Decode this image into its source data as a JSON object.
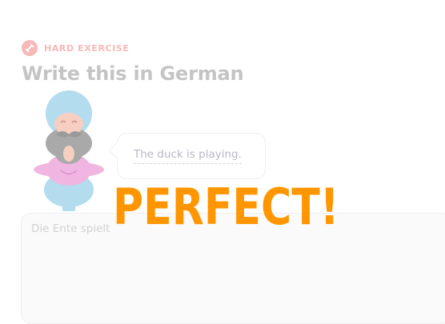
{
  "header": {
    "badge_label": "HARD EXERCISE",
    "badge_icon": "dumbbell-icon",
    "title": "Write this in German"
  },
  "prompt": {
    "character_icon": "bearded-man-character",
    "sentence": "The duck is playing."
  },
  "answer": {
    "value": "Die Ente spielt"
  },
  "feedback": {
    "text": "PERFECT!"
  },
  "colors": {
    "badge": "#f7b8b8",
    "title": "#c4c4c4",
    "bubble_text": "#b8b8c8",
    "answer_text": "#d2d2d2",
    "answer_bg": "#fafafa",
    "feedback": "#ff9600",
    "turban": "#b3dcef",
    "beard": "#a9a9a9",
    "skin": "#f6cfc1",
    "shirt": "#f0b6e1",
    "pants": "#b3dcef"
  }
}
